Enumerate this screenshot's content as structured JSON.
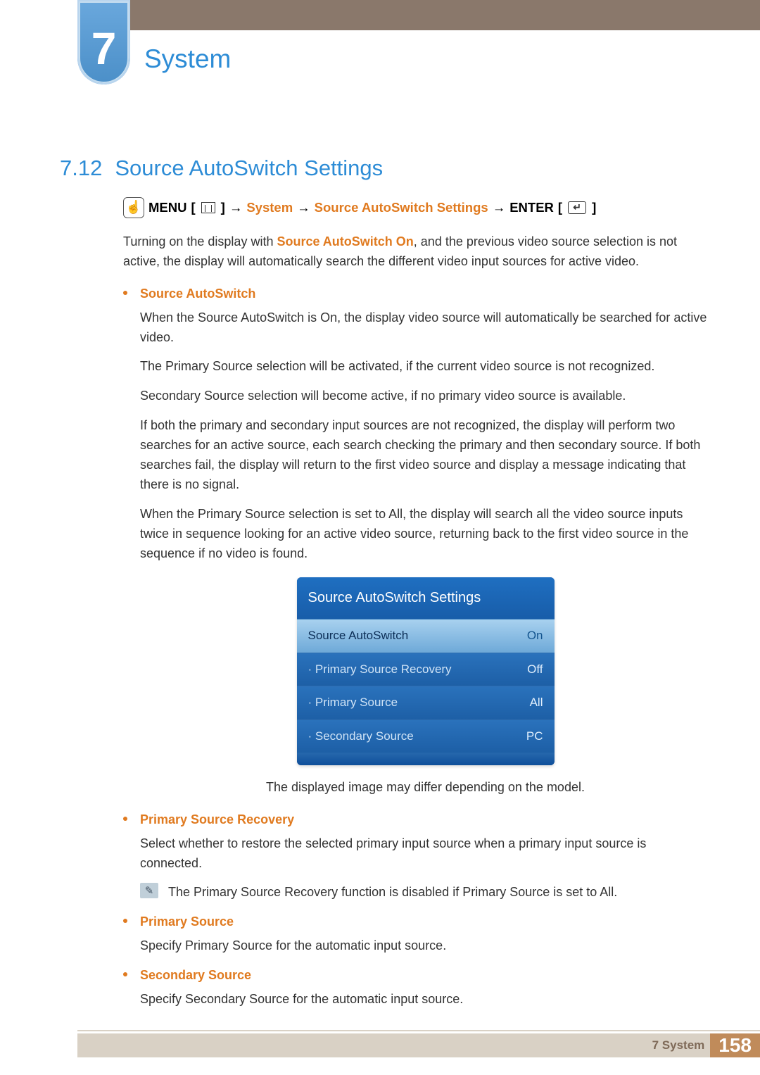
{
  "chapter": {
    "number": "7",
    "title": "System"
  },
  "section": {
    "number": "7.12",
    "title": "Source AutoSwitch Settings"
  },
  "nav": {
    "menu": "MENU",
    "arrow": "→",
    "system": "System",
    "settings": "Source AutoSwitch Settings",
    "enter": "ENTER"
  },
  "intro": {
    "pre": "Turning on the display with ",
    "bold": "Source AutoSwitch On",
    "post": ", and the previous video source selection is not active, the display will automatically search the different video input sources for active video."
  },
  "b1": {
    "head": "Source AutoSwitch",
    "p1a": "When the ",
    "p1b": "Source AutoSwitch",
    "p1c": " is ",
    "p1d": "On",
    "p1e": ", the display video source will automatically be searched for active video.",
    "p2a": "The ",
    "p2b": "Primary Source",
    "p2c": " selection will be activated, if the current video source is not recognized.",
    "p3a": "Secondary Source",
    "p3b": " selection will become active, if no primary video source is available.",
    "p4": "If both the primary and secondary input sources are not recognized, the display will perform two searches for an active source, each search checking the primary and then secondary source. If both searches fail, the display will return to the first video source and display a message indicating that there is no signal.",
    "p5a": "When the ",
    "p5b": "Primary Source",
    "p5c": " selection is set to ",
    "p5d": "All",
    "p5e": ", the display will search all the video source inputs twice in sequence looking for an active video source, returning back to the first video source in the sequence if no video is found."
  },
  "osd": {
    "title": "Source AutoSwitch Settings",
    "rows": [
      {
        "label": "Source AutoSwitch",
        "value": "On"
      },
      {
        "label": "Primary Source Recovery",
        "value": "Off"
      },
      {
        "label": "Primary Source",
        "value": "All"
      },
      {
        "label": "Secondary Source",
        "value": "PC"
      }
    ]
  },
  "caption": "The displayed image may differ depending on the model.",
  "b2": {
    "head": "Primary Source Recovery",
    "p": "Select whether to restore the selected primary input source when a primary input source is connected.",
    "note_a": "The ",
    "note_b": "Primary Source Recovery",
    "note_c": " function is disabled if ",
    "note_d": "Primary Source",
    "note_e": " is set to ",
    "note_f": "All",
    "note_g": "."
  },
  "b3": {
    "head": "Primary Source",
    "pa": "Specify ",
    "pb": "Primary Source",
    "pc": " for the automatic input source."
  },
  "b4": {
    "head": "Secondary Source",
    "pa": "Specify ",
    "pb": "Secondary Source",
    "pc": " for the automatic input source."
  },
  "footer": {
    "chapter": "7 System",
    "page": "158"
  }
}
